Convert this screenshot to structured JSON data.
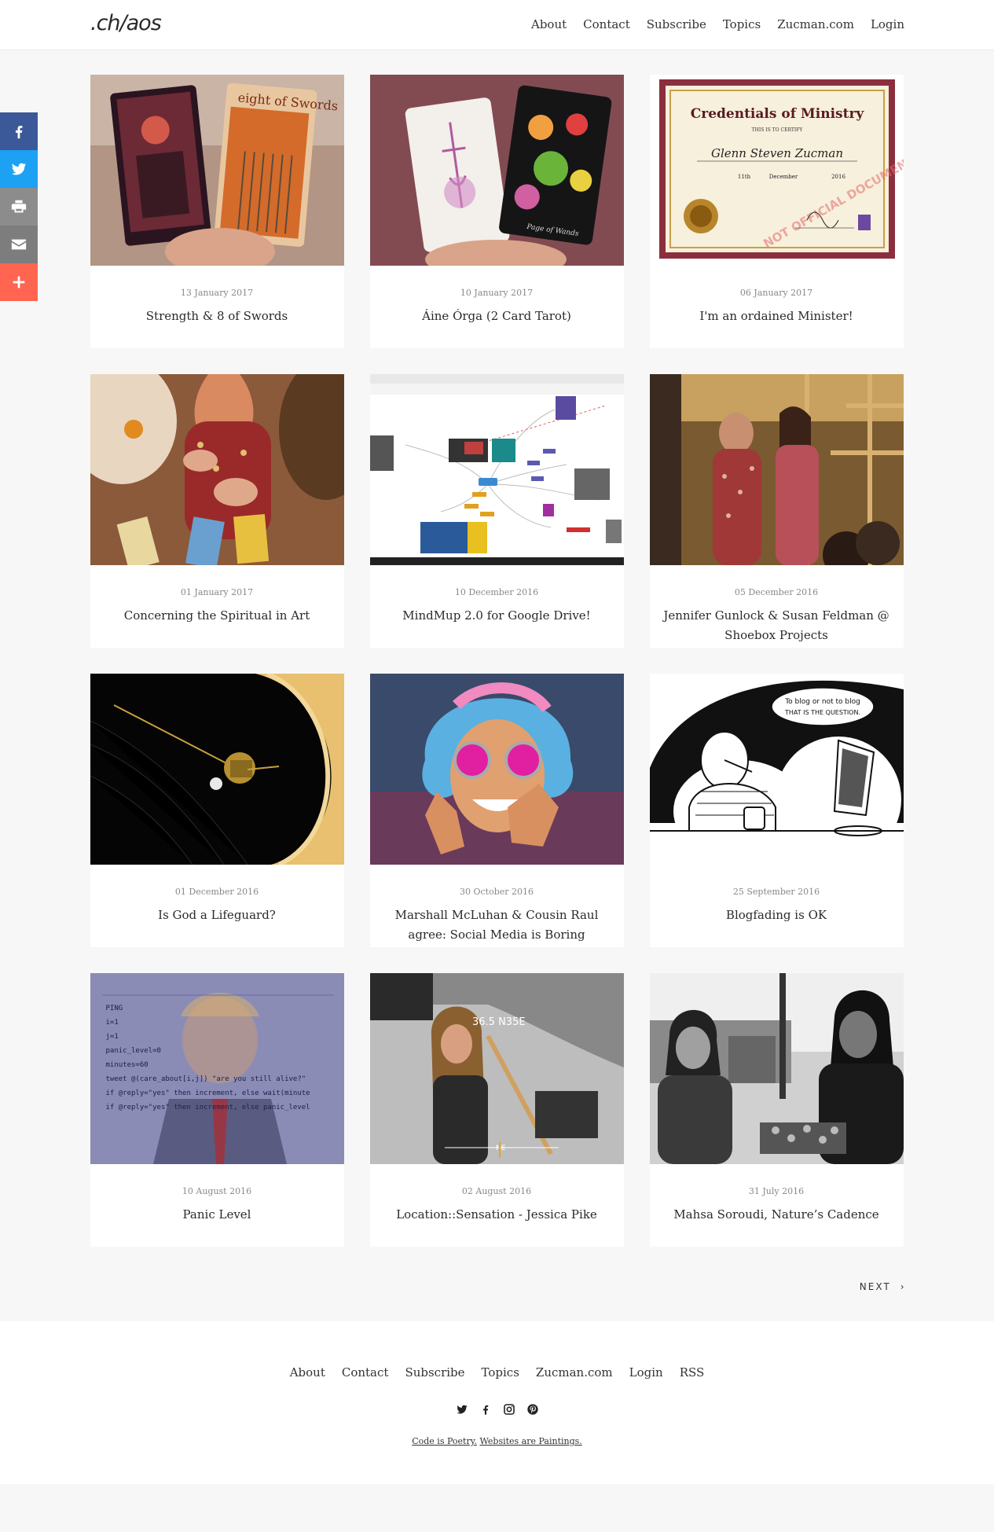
{
  "site": {
    "logo": ".ch/aos",
    "nav": [
      "About",
      "Contact",
      "Subscribe",
      "Topics",
      "Zucman.com",
      "Login"
    ]
  },
  "share": {
    "icons": [
      "facebook-icon",
      "twitter-icon",
      "print-icon",
      "email-icon",
      "plus-icon"
    ],
    "colors": [
      "#3b5998",
      "#1da1f2",
      "#8c8c8c",
      "#7d7d7d",
      "#ff6550"
    ]
  },
  "posts": [
    {
      "date": "13 January 2017",
      "title": "Strength & 8 of Swords"
    },
    {
      "date": "10 January 2017",
      "title": "Áine Órga (2 Card Tarot)"
    },
    {
      "date": "06 January 2017",
      "title": "I'm an ordained Minister!"
    },
    {
      "date": "01 January 2017",
      "title": "Concerning the Spiritual in Art"
    },
    {
      "date": "10 December 2016",
      "title": "MindMup 2.0 for Google Drive!"
    },
    {
      "date": "05 December 2016",
      "title": "Jennifer Gunlock & Susan Feldman @ Shoebox Projects"
    },
    {
      "date": "01 December 2016",
      "title": "Is God a Lifeguard?"
    },
    {
      "date": "30 October 2016",
      "title": "Marshall McLuhan & Cousin Raul agree: Social Media is Boring"
    },
    {
      "date": "25 September 2016",
      "title": "Blogfading is OK"
    },
    {
      "date": "10 August 2016",
      "title": "Panic Level"
    },
    {
      "date": "02 August 2016",
      "title": "Location::Sensation - Jessica Pike"
    },
    {
      "date": "31 July 2016",
      "title": "Mahsa Soroudi, Nature’s Cadence"
    }
  ],
  "images": {
    "tarot_card_1": "eight of Swords",
    "tarot_card_2": "Page of Wands",
    "certificate": {
      "heading": "Credentials of Ministry",
      "subheading": "THIS IS TO CERTIFY",
      "name": "Glenn Steven Zucman",
      "watermark": "NOT OFFICIAL DOCUMENT",
      "day": "11th",
      "month": "December",
      "year": "2016"
    },
    "cartoon_bubble": [
      "To blog or not to blog",
      "THAT IS THE QUESTION."
    ],
    "panic_code": [
      "PING",
      "i=1",
      "j=1",
      "panic_level=0",
      "minutes=60",
      "tweet @(care_about[i,j]) \"are you still alive?\"",
      "if @reply=\"yes\" then increment, else wait(minute",
      "if @reply=\"yes\" then increment, else panic_level"
    ],
    "location_hud": [
      "36.5 N35E",
      "NE"
    ]
  },
  "pagination": {
    "next": "NEXT"
  },
  "footer": {
    "nav": [
      "About",
      "Contact",
      "Subscribe",
      "Topics",
      "Zucman.com",
      "Login",
      "RSS"
    ],
    "social": [
      "twitter-icon",
      "facebook-icon",
      "instagram-icon",
      "pinterest-icon"
    ],
    "tagline_1": "Code is Poetry.",
    "tagline_2": "Websites are Paintings."
  }
}
